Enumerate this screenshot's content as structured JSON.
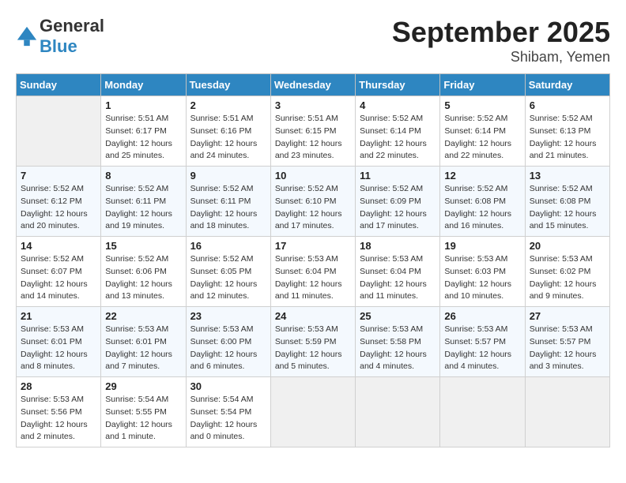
{
  "header": {
    "logo": {
      "general": "General",
      "blue": "Blue"
    },
    "month": "September 2025",
    "location": "Shibam, Yemen"
  },
  "days_of_week": [
    "Sunday",
    "Monday",
    "Tuesday",
    "Wednesday",
    "Thursday",
    "Friday",
    "Saturday"
  ],
  "weeks": [
    [
      {
        "day": "",
        "sunrise": "",
        "sunset": "",
        "daylight": "",
        "empty": true
      },
      {
        "day": "1",
        "sunrise": "Sunrise: 5:51 AM",
        "sunset": "Sunset: 6:17 PM",
        "daylight": "Daylight: 12 hours and 25 minutes."
      },
      {
        "day": "2",
        "sunrise": "Sunrise: 5:51 AM",
        "sunset": "Sunset: 6:16 PM",
        "daylight": "Daylight: 12 hours and 24 minutes."
      },
      {
        "day": "3",
        "sunrise": "Sunrise: 5:51 AM",
        "sunset": "Sunset: 6:15 PM",
        "daylight": "Daylight: 12 hours and 23 minutes."
      },
      {
        "day": "4",
        "sunrise": "Sunrise: 5:52 AM",
        "sunset": "Sunset: 6:14 PM",
        "daylight": "Daylight: 12 hours and 22 minutes."
      },
      {
        "day": "5",
        "sunrise": "Sunrise: 5:52 AM",
        "sunset": "Sunset: 6:14 PM",
        "daylight": "Daylight: 12 hours and 22 minutes."
      },
      {
        "day": "6",
        "sunrise": "Sunrise: 5:52 AM",
        "sunset": "Sunset: 6:13 PM",
        "daylight": "Daylight: 12 hours and 21 minutes."
      }
    ],
    [
      {
        "day": "7",
        "sunrise": "Sunrise: 5:52 AM",
        "sunset": "Sunset: 6:12 PM",
        "daylight": "Daylight: 12 hours and 20 minutes."
      },
      {
        "day": "8",
        "sunrise": "Sunrise: 5:52 AM",
        "sunset": "Sunset: 6:11 PM",
        "daylight": "Daylight: 12 hours and 19 minutes."
      },
      {
        "day": "9",
        "sunrise": "Sunrise: 5:52 AM",
        "sunset": "Sunset: 6:11 PM",
        "daylight": "Daylight: 12 hours and 18 minutes."
      },
      {
        "day": "10",
        "sunrise": "Sunrise: 5:52 AM",
        "sunset": "Sunset: 6:10 PM",
        "daylight": "Daylight: 12 hours and 17 minutes."
      },
      {
        "day": "11",
        "sunrise": "Sunrise: 5:52 AM",
        "sunset": "Sunset: 6:09 PM",
        "daylight": "Daylight: 12 hours and 17 minutes."
      },
      {
        "day": "12",
        "sunrise": "Sunrise: 5:52 AM",
        "sunset": "Sunset: 6:08 PM",
        "daylight": "Daylight: 12 hours and 16 minutes."
      },
      {
        "day": "13",
        "sunrise": "Sunrise: 5:52 AM",
        "sunset": "Sunset: 6:08 PM",
        "daylight": "Daylight: 12 hours and 15 minutes."
      }
    ],
    [
      {
        "day": "14",
        "sunrise": "Sunrise: 5:52 AM",
        "sunset": "Sunset: 6:07 PM",
        "daylight": "Daylight: 12 hours and 14 minutes."
      },
      {
        "day": "15",
        "sunrise": "Sunrise: 5:52 AM",
        "sunset": "Sunset: 6:06 PM",
        "daylight": "Daylight: 12 hours and 13 minutes."
      },
      {
        "day": "16",
        "sunrise": "Sunrise: 5:52 AM",
        "sunset": "Sunset: 6:05 PM",
        "daylight": "Daylight: 12 hours and 12 minutes."
      },
      {
        "day": "17",
        "sunrise": "Sunrise: 5:53 AM",
        "sunset": "Sunset: 6:04 PM",
        "daylight": "Daylight: 12 hours and 11 minutes."
      },
      {
        "day": "18",
        "sunrise": "Sunrise: 5:53 AM",
        "sunset": "Sunset: 6:04 PM",
        "daylight": "Daylight: 12 hours and 11 minutes."
      },
      {
        "day": "19",
        "sunrise": "Sunrise: 5:53 AM",
        "sunset": "Sunset: 6:03 PM",
        "daylight": "Daylight: 12 hours and 10 minutes."
      },
      {
        "day": "20",
        "sunrise": "Sunrise: 5:53 AM",
        "sunset": "Sunset: 6:02 PM",
        "daylight": "Daylight: 12 hours and 9 minutes."
      }
    ],
    [
      {
        "day": "21",
        "sunrise": "Sunrise: 5:53 AM",
        "sunset": "Sunset: 6:01 PM",
        "daylight": "Daylight: 12 hours and 8 minutes."
      },
      {
        "day": "22",
        "sunrise": "Sunrise: 5:53 AM",
        "sunset": "Sunset: 6:01 PM",
        "daylight": "Daylight: 12 hours and 7 minutes."
      },
      {
        "day": "23",
        "sunrise": "Sunrise: 5:53 AM",
        "sunset": "Sunset: 6:00 PM",
        "daylight": "Daylight: 12 hours and 6 minutes."
      },
      {
        "day": "24",
        "sunrise": "Sunrise: 5:53 AM",
        "sunset": "Sunset: 5:59 PM",
        "daylight": "Daylight: 12 hours and 5 minutes."
      },
      {
        "day": "25",
        "sunrise": "Sunrise: 5:53 AM",
        "sunset": "Sunset: 5:58 PM",
        "daylight": "Daylight: 12 hours and 4 minutes."
      },
      {
        "day": "26",
        "sunrise": "Sunrise: 5:53 AM",
        "sunset": "Sunset: 5:57 PM",
        "daylight": "Daylight: 12 hours and 4 minutes."
      },
      {
        "day": "27",
        "sunrise": "Sunrise: 5:53 AM",
        "sunset": "Sunset: 5:57 PM",
        "daylight": "Daylight: 12 hours and 3 minutes."
      }
    ],
    [
      {
        "day": "28",
        "sunrise": "Sunrise: 5:53 AM",
        "sunset": "Sunset: 5:56 PM",
        "daylight": "Daylight: 12 hours and 2 minutes."
      },
      {
        "day": "29",
        "sunrise": "Sunrise: 5:54 AM",
        "sunset": "Sunset: 5:55 PM",
        "daylight": "Daylight: 12 hours and 1 minute."
      },
      {
        "day": "30",
        "sunrise": "Sunrise: 5:54 AM",
        "sunset": "Sunset: 5:54 PM",
        "daylight": "Daylight: 12 hours and 0 minutes."
      },
      {
        "day": "",
        "sunrise": "",
        "sunset": "",
        "daylight": "",
        "empty": true
      },
      {
        "day": "",
        "sunrise": "",
        "sunset": "",
        "daylight": "",
        "empty": true
      },
      {
        "day": "",
        "sunrise": "",
        "sunset": "",
        "daylight": "",
        "empty": true
      },
      {
        "day": "",
        "sunrise": "",
        "sunset": "",
        "daylight": "",
        "empty": true
      }
    ]
  ]
}
